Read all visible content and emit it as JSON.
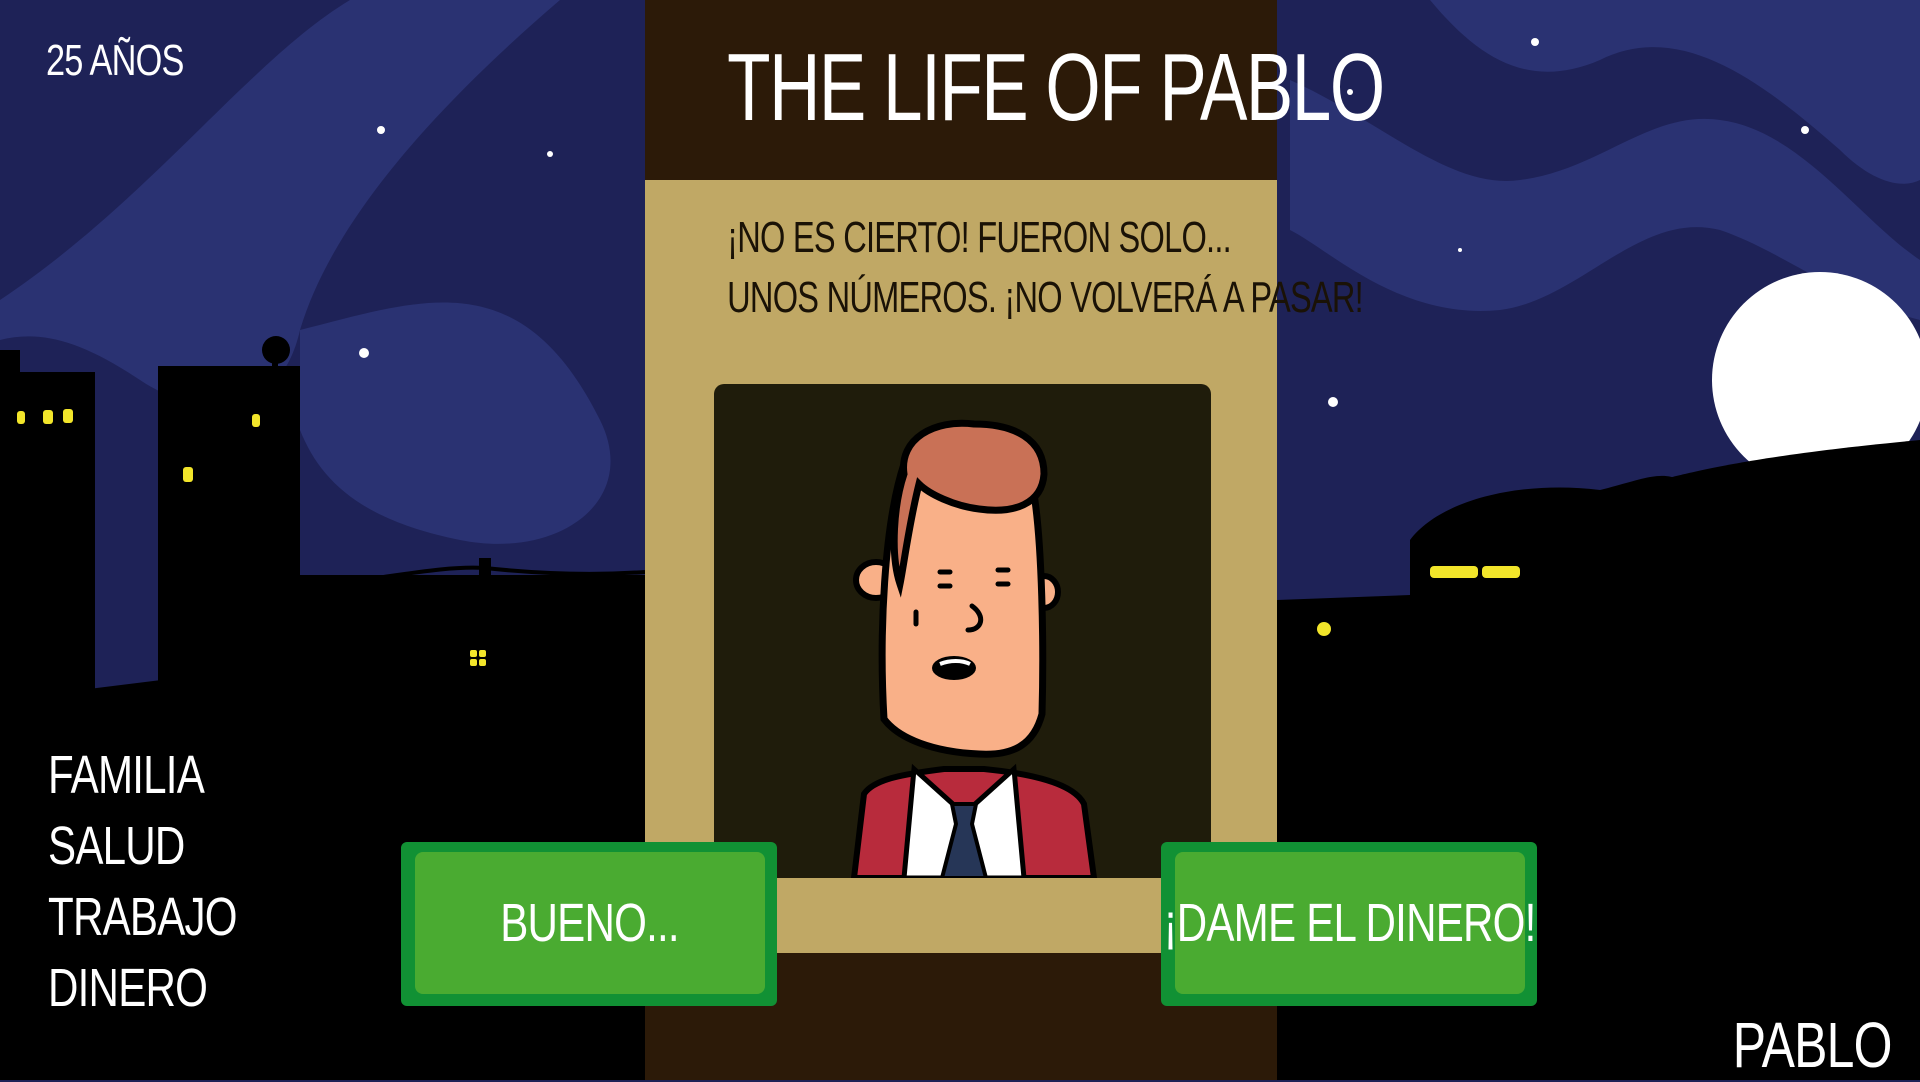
{
  "hud": {
    "age": "25 AÑOS",
    "stats": [
      "FAMILIA",
      "SALUD",
      "TRABAJO",
      "DINERO"
    ],
    "player_name": "PABLO"
  },
  "card": {
    "title": "THE LIFE OF PABLO",
    "dialog_line_1": "¡NO ES CIERTO! FUERON SOLO...",
    "dialog_line_2": "UNOS NÚMEROS. ¡NO VOLVERÁ A PASAR!",
    "character_icon": "pablo-portrait"
  },
  "choices": {
    "left": "BUENO...",
    "right": "¡DAME EL DINERO!"
  },
  "colors": {
    "sky": "#1e2257",
    "sky_light": "#2a3272",
    "buildings": "#000000",
    "window_light": "#f2e52a",
    "card_dark": "#2c1a08",
    "card_panel": "#c0a865",
    "button_border": "#119134",
    "button_fill": "#4aab31"
  }
}
